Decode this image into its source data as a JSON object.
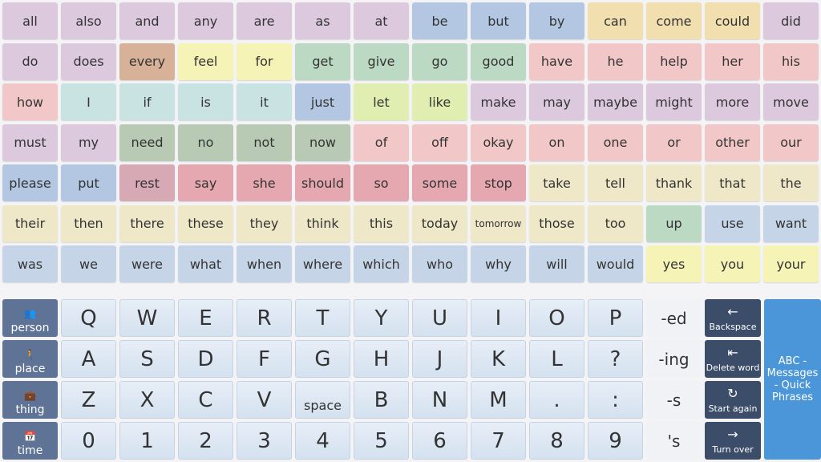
{
  "words": [
    {
      "label": "all",
      "c": "purple"
    },
    {
      "label": "also",
      "c": "purple"
    },
    {
      "label": "and",
      "c": "purple"
    },
    {
      "label": "any",
      "c": "purple"
    },
    {
      "label": "are",
      "c": "purple"
    },
    {
      "label": "as",
      "c": "purple"
    },
    {
      "label": "at",
      "c": "purple"
    },
    {
      "label": "be",
      "c": "blue"
    },
    {
      "label": "but",
      "c": "blue"
    },
    {
      "label": "by",
      "c": "blue"
    },
    {
      "label": "can",
      "c": "orange"
    },
    {
      "label": "come",
      "c": "orange"
    },
    {
      "label": "could",
      "c": "orange"
    },
    {
      "label": "did",
      "c": "purple"
    },
    {
      "label": "do",
      "c": "purple"
    },
    {
      "label": "does",
      "c": "purple"
    },
    {
      "label": "every",
      "c": "brown"
    },
    {
      "label": "feel",
      "c": "yellow"
    },
    {
      "label": "for",
      "c": "yellow"
    },
    {
      "label": "get",
      "c": "green"
    },
    {
      "label": "give",
      "c": "green"
    },
    {
      "label": "go",
      "c": "green"
    },
    {
      "label": "good",
      "c": "green"
    },
    {
      "label": "have",
      "c": "pink"
    },
    {
      "label": "he",
      "c": "pink"
    },
    {
      "label": "help",
      "c": "pink"
    },
    {
      "label": "her",
      "c": "pink"
    },
    {
      "label": "his",
      "c": "pink"
    },
    {
      "label": "how",
      "c": "pink"
    },
    {
      "label": "I",
      "c": "teal"
    },
    {
      "label": "if",
      "c": "teal"
    },
    {
      "label": "is",
      "c": "teal"
    },
    {
      "label": "it",
      "c": "teal"
    },
    {
      "label": "just",
      "c": "blue"
    },
    {
      "label": "let",
      "c": "lime"
    },
    {
      "label": "like",
      "c": "lime"
    },
    {
      "label": "make",
      "c": "purple"
    },
    {
      "label": "may",
      "c": "purple"
    },
    {
      "label": "maybe",
      "c": "purple"
    },
    {
      "label": "might",
      "c": "purple"
    },
    {
      "label": "more",
      "c": "purple"
    },
    {
      "label": "move",
      "c": "purple"
    },
    {
      "label": "must",
      "c": "purple"
    },
    {
      "label": "my",
      "c": "purple"
    },
    {
      "label": "need",
      "c": "olive"
    },
    {
      "label": "no",
      "c": "olive"
    },
    {
      "label": "not",
      "c": "olive"
    },
    {
      "label": "now",
      "c": "olive"
    },
    {
      "label": "of",
      "c": "pink"
    },
    {
      "label": "off",
      "c": "pink"
    },
    {
      "label": "okay",
      "c": "pink"
    },
    {
      "label": "on",
      "c": "pink"
    },
    {
      "label": "one",
      "c": "pink"
    },
    {
      "label": "or",
      "c": "pink"
    },
    {
      "label": "other",
      "c": "pink"
    },
    {
      "label": "our",
      "c": "pink"
    },
    {
      "label": "please",
      "c": "blue"
    },
    {
      "label": "put",
      "c": "blue"
    },
    {
      "label": "rest",
      "c": "mauve"
    },
    {
      "label": "say",
      "c": "rose"
    },
    {
      "label": "she",
      "c": "rose"
    },
    {
      "label": "should",
      "c": "rose"
    },
    {
      "label": "so",
      "c": "rose"
    },
    {
      "label": "some",
      "c": "rose"
    },
    {
      "label": "stop",
      "c": "rose"
    },
    {
      "label": "take",
      "c": "cream"
    },
    {
      "label": "tell",
      "c": "cream"
    },
    {
      "label": "thank",
      "c": "cream"
    },
    {
      "label": "that",
      "c": "cream"
    },
    {
      "label": "the",
      "c": "cream"
    },
    {
      "label": "their",
      "c": "cream"
    },
    {
      "label": "then",
      "c": "cream"
    },
    {
      "label": "there",
      "c": "cream"
    },
    {
      "label": "these",
      "c": "cream"
    },
    {
      "label": "they",
      "c": "cream"
    },
    {
      "label": "think",
      "c": "cream"
    },
    {
      "label": "this",
      "c": "cream"
    },
    {
      "label": "today",
      "c": "cream"
    },
    {
      "label": "tomorrow",
      "c": "cream",
      "small": true
    },
    {
      "label": "those",
      "c": "cream"
    },
    {
      "label": "too",
      "c": "cream"
    },
    {
      "label": "up",
      "c": "green"
    },
    {
      "label": "use",
      "c": "ltblue"
    },
    {
      "label": "want",
      "c": "ltblue"
    },
    {
      "label": "was",
      "c": "ltblue"
    },
    {
      "label": "we",
      "c": "ltblue"
    },
    {
      "label": "were",
      "c": "ltblue"
    },
    {
      "label": "what",
      "c": "ltblue"
    },
    {
      "label": "when",
      "c": "ltblue"
    },
    {
      "label": "where",
      "c": "ltblue"
    },
    {
      "label": "which",
      "c": "ltblue"
    },
    {
      "label": "who",
      "c": "ltblue"
    },
    {
      "label": "why",
      "c": "ltblue"
    },
    {
      "label": "will",
      "c": "ltblue"
    },
    {
      "label": "would",
      "c": "ltblue"
    },
    {
      "label": "yes",
      "c": "yellow"
    },
    {
      "label": "you",
      "c": "yellow"
    },
    {
      "label": "your",
      "c": "yellow"
    }
  ],
  "categories": [
    {
      "label": "person",
      "icon": "people-icon"
    },
    {
      "label": "place",
      "icon": "walking-icon"
    },
    {
      "label": "thing",
      "icon": "box-icon"
    },
    {
      "label": "time",
      "icon": "calendar-icon"
    }
  ],
  "keyrows": [
    [
      "Q",
      "W",
      "E",
      "R",
      "T",
      "Y",
      "U",
      "I",
      "O",
      "P"
    ],
    [
      "A",
      "S",
      "D",
      "F",
      "G",
      "H",
      "J",
      "K",
      "L",
      "?"
    ],
    [
      "Z",
      "X",
      "C",
      "V",
      "space",
      "B",
      "N",
      "M",
      ".",
      ":"
    ],
    [
      "0",
      "1",
      "2",
      "3",
      "4",
      "5",
      "6",
      "7",
      "8",
      "9"
    ]
  ],
  "suffixes": [
    "-ed",
    "-ing",
    "-s",
    "'s"
  ],
  "actions": [
    {
      "label": "Backspace",
      "icon": "arrow-left-icon"
    },
    {
      "label": "Delete word",
      "icon": "delete-word-icon"
    },
    {
      "label": "Start again",
      "icon": "refresh-icon"
    },
    {
      "label": "Turn over",
      "icon": "arrow-right-icon"
    }
  ],
  "big_button": {
    "label": "ABC - Messages - Quick Phrases"
  },
  "colors": {
    "purple": "#dcc9de",
    "blue": "#b3c6e2",
    "orange": "#f1dfb0",
    "pink": "#f2c7c8",
    "brown": "#d7b198",
    "yellow": "#f5f3b6",
    "green": "#bcd9c3",
    "teal": "#c9e2e2",
    "lime": "#e0efb1",
    "olive": "#b8c9b4",
    "rose": "#e6a8b0",
    "mauve": "#d6a9b5",
    "cream": "#eee7c8",
    "ltblue": "#c5d5e7",
    "category": "#5e7396",
    "action": "#3c4d6a",
    "accent": "#4a96d8"
  }
}
